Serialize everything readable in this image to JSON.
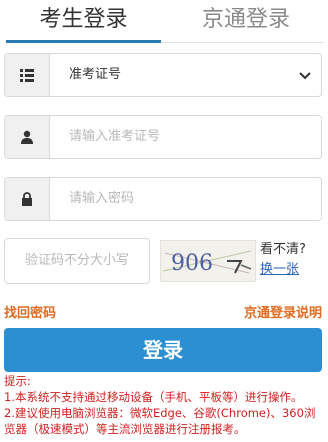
{
  "tabs": {
    "candidate_login": "考生登录",
    "jingtong_login": "京通登录"
  },
  "form": {
    "id_type_value": "准考证号",
    "id_number_placeholder": "请输入准考证号",
    "password_placeholder": "请输入密码",
    "captcha_placeholder": "验证码不分大小写",
    "captcha_image_text": "906",
    "captcha_unclear": "看不清?",
    "captcha_change": "换一张",
    "forgot_password": "找回密码",
    "jingtong_help": "京通登录说明",
    "login_button": "登录"
  },
  "notice": {
    "title": "提示:",
    "line1": "1.本系统不支持通过移动设备（手机、平板等）进行操作。",
    "line2": "2.建议使用电脑浏览器：微软Edge、谷歌(Chrome)、360浏览器（极速模式）等主流浏览器进行注册报考。"
  },
  "colors": {
    "accent": "#2a7ab7",
    "button": "#2b8fd2",
    "link_orange": "#e06b20",
    "notice_red": "#d11f1f"
  },
  "icons": {
    "id_type": "list-icon",
    "user": "user-icon",
    "password": "lock-icon",
    "select": "chevron-down-icon"
  }
}
